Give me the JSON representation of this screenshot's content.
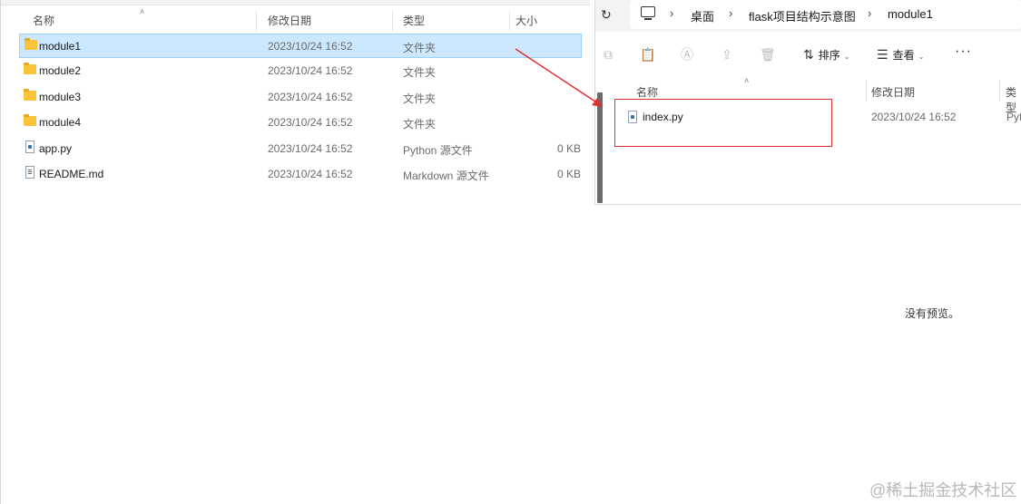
{
  "left": {
    "columns": {
      "name": "名称",
      "modified": "修改日期",
      "type": "类型",
      "size": "大小"
    },
    "rows": [
      {
        "name": "module1",
        "modified": "2023/10/24 16:52",
        "type": "文件夹",
        "size": ""
      },
      {
        "name": "module2",
        "modified": "2023/10/24 16:52",
        "type": "文件夹",
        "size": ""
      },
      {
        "name": "module3",
        "modified": "2023/10/24 16:52",
        "type": "文件夹",
        "size": ""
      },
      {
        "name": "module4",
        "modified": "2023/10/24 16:52",
        "type": "文件夹",
        "size": ""
      },
      {
        "name": "app.py",
        "modified": "2023/10/24 16:52",
        "type": "Python 源文件",
        "size": "0 KB"
      },
      {
        "name": "README.md",
        "modified": "2023/10/24 16:52",
        "type": "Markdown 源文件",
        "size": "0 KB"
      }
    ],
    "selected_row": "module1"
  },
  "right": {
    "breadcrumb": [
      "桌面",
      "flask项目结构示意图",
      "module1"
    ],
    "toolbar": {
      "sort_label": "排序",
      "view_label": "查看",
      "more": "···"
    },
    "columns": {
      "name": "名称",
      "modified": "修改日期",
      "type": "类型"
    },
    "rows": [
      {
        "name": "index.py",
        "modified": "2023/10/24 16:52",
        "type": "Pyt"
      }
    ]
  },
  "preview": {
    "empty_text": "没有预览。"
  },
  "watermark": "@稀土掘金技术社区",
  "colors": {
    "selection_bg": "#cce8ff",
    "highlight": "#e03131",
    "folder": "#f9c33a"
  }
}
